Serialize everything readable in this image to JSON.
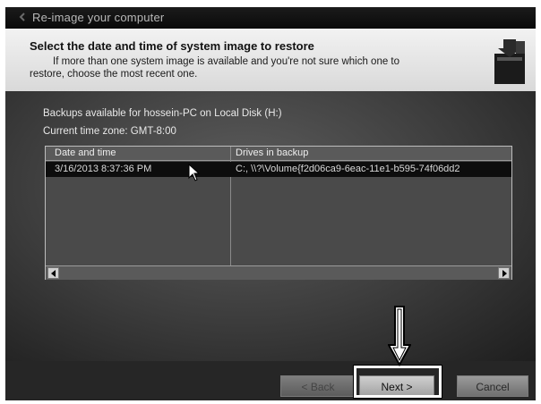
{
  "window": {
    "title": "Re-image your computer"
  },
  "header": {
    "heading": "Select the date and time of system image to restore",
    "description_line1": "If more than one system image is available and you're not sure which one to",
    "description_line2": "restore, choose the most recent one."
  },
  "main": {
    "backups_label": "Backups available for hossein-PC on Local Disk (H:)",
    "timezone_label": "Current time zone: GMT-8:00",
    "table": {
      "columns": [
        "Date and time",
        "Drives in backup"
      ],
      "rows": [
        {
          "date_time": "3/16/2013 8:37:36 PM",
          "drives": "C:, \\\\?\\Volume{f2d06ca9-6eac-11e1-b595-74f06dd2"
        }
      ]
    }
  },
  "footer": {
    "back_label": "< Back",
    "next_label": "Next >",
    "cancel_label": "Cancel"
  },
  "icons": {
    "header_logo": "backup-drive-icon",
    "annotation_arrow": "down-arrow-icon",
    "pointer": "mouse-pointer-icon"
  }
}
